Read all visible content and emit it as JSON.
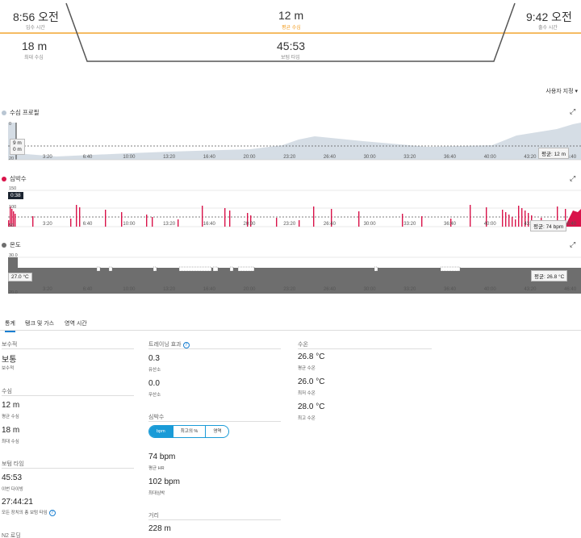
{
  "summary": {
    "entry_time": {
      "value": "8:56 오전",
      "label": "입수 시간"
    },
    "avg_depth": {
      "value": "12 m",
      "label": "평균 수심"
    },
    "exit_time": {
      "value": "9:42 오전",
      "label": "출수 시간"
    },
    "max_depth": {
      "value": "18 m",
      "label": "최대 수심"
    },
    "bottom_time": {
      "value": "45:53",
      "label": "보텀 타임"
    }
  },
  "customize_label": "사용자 지정",
  "charts": {
    "x_ticks": [
      "3:20",
      "6:40",
      "10:00",
      "13:20",
      "16:40",
      "20:00",
      "23:20",
      "26:40",
      "30:00",
      "33:20",
      "36:40",
      "40:00",
      "43:20",
      "46:40"
    ],
    "depth": {
      "title": "수심 프로필",
      "y_ticks": [
        "0",
        "20"
      ],
      "cursor_top": "9 m",
      "cursor_bottom": "0 m",
      "avg_badge": "평균: 12 m",
      "color": "#b9c6d3"
    },
    "hr": {
      "title": "심박수",
      "y_ticks": [
        "150",
        "100",
        "50"
      ],
      "cursor": "0:38",
      "avg_badge": "평균: 74 bpm",
      "color": "#d9134a"
    },
    "temp": {
      "title": "온도",
      "y_ticks": [
        "30.0",
        "20.0"
      ],
      "cursor": "27.0 °C",
      "avg_badge": "평균: 26.8 °C",
      "color": "#6e6e6e"
    }
  },
  "tabs": [
    "통계",
    "탱크 및 가스",
    "영역 시간"
  ],
  "stats": {
    "col1": {
      "conservatism": {
        "title": "보수적",
        "value": "보통",
        "label": "보수적"
      },
      "depth": {
        "title": "수심",
        "items": [
          {
            "value": "12 m",
            "label": "평균 수심"
          },
          {
            "value": "18 m",
            "label": "최대 수심"
          }
        ]
      },
      "bottom": {
        "title": "보텀 타임",
        "items": [
          {
            "value": "45:53",
            "label": "이번 다이빙"
          },
          {
            "value": "27:44:21",
            "label": "모든 장치의 총 보텀 타임"
          }
        ]
      },
      "n2": {
        "title": "N2 로딩"
      }
    },
    "col2": {
      "training": {
        "title": "트레이닝 효과",
        "items": [
          {
            "value": "0.3",
            "label": "유산소"
          },
          {
            "value": "0.0",
            "label": "무산소"
          }
        ]
      },
      "hr": {
        "title": "심박수",
        "segments": [
          "bpm",
          "최고의 %",
          "영역"
        ],
        "items": [
          {
            "value": "74 bpm",
            "label": "평균 HR"
          },
          {
            "value": "102 bpm",
            "label": "최대심박"
          }
        ]
      },
      "distance": {
        "title": "거리",
        "value": "228 m"
      }
    },
    "col3": {
      "temp": {
        "title": "수온",
        "items": [
          {
            "value": "26.8 °C",
            "label": "평균 수온"
          },
          {
            "value": "26.0 °C",
            "label": "최저 수온"
          },
          {
            "value": "28.0 °C",
            "label": "최고 수온"
          }
        ]
      }
    }
  }
}
